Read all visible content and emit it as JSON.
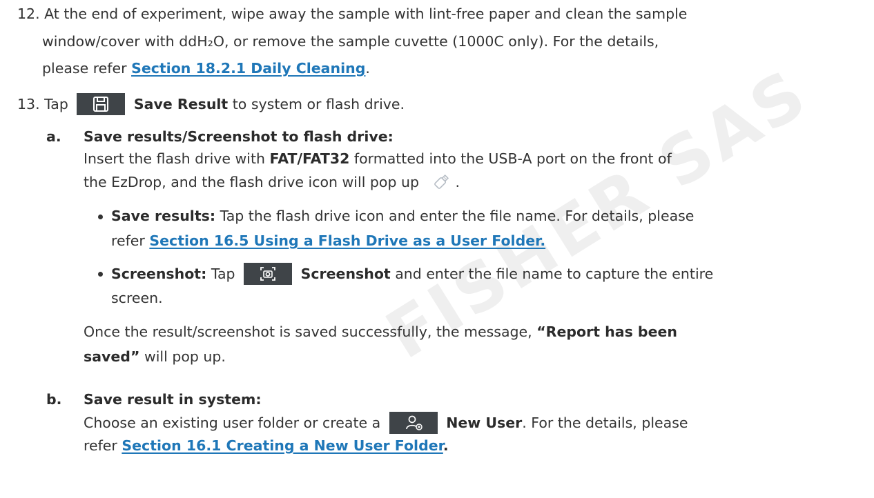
{
  "watermark": "FISHER SAS",
  "item12": {
    "number": "12.",
    "line1": "At the end of experiment, wipe away the sample with lint-free paper and clean the sample",
    "line2": "window/cover with ddH₂O, or remove the sample cuvette (1000C only). For the details,",
    "line3_pre": "please refer ",
    "line3_link": "Section 18.2.1 Daily Cleaning",
    "line3_post": "."
  },
  "item13": {
    "number": "13.",
    "tap": "Tap",
    "button_label": "Save Result",
    "post": " to system or flash drive."
  },
  "sub_a": {
    "letter": "a.",
    "heading": "Save results/Screenshot to flash drive:",
    "l1_pre": "Insert the flash drive with ",
    "l1_bold": "FAT/FAT32",
    "l1_post": " formatted into the USB-A port on the front of",
    "l2": "the EzDrop, and the flash drive icon will pop up",
    "l2_end": ".",
    "bullet1_bold": "Save results:",
    "bullet1_text": " Tap the flash drive icon and enter the file name. For details, please",
    "bullet1_l2_pre": "refer ",
    "bullet1_link": "Section 16.5 Using a Flash Drive as a User Folder.",
    "bullet2_bold": "Screenshot:",
    "bullet2_tap": " Tap",
    "bullet2_button": "Screenshot",
    "bullet2_text": " and enter the file name to capture the entire",
    "bullet2_l2": "screen.",
    "once_pre": "Once the result/screenshot is saved successfully, the message, ",
    "once_bold": "“Report has been",
    "once_bold2": "saved”",
    "once_post": " will pop up."
  },
  "sub_b": {
    "letter": "b.",
    "heading": "Save result in system:",
    "l1_pre": "Choose an existing user folder or create a",
    "l1_button": "New User",
    "l1_post": ". For the details, please",
    "l2_pre": "refer ",
    "l2_link": "Section 16.1 Creating a New User Folder",
    "l2_end": "."
  }
}
